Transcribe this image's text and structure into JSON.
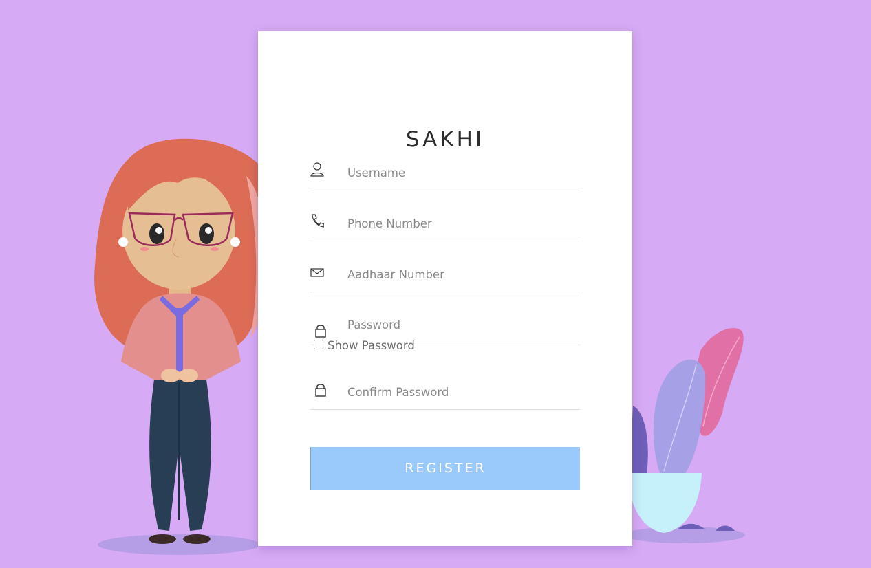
{
  "app": {
    "title": "SAKHI"
  },
  "form": {
    "username": {
      "placeholder": "Username",
      "icon": "user-icon"
    },
    "phone": {
      "placeholder": "Phone Number",
      "icon": "phone-icon"
    },
    "aadhaar": {
      "placeholder": "Aadhaar Number",
      "icon": "envelope-icon"
    },
    "password": {
      "placeholder": "Password",
      "icon": "lock-icon"
    },
    "show_password": {
      "label": "Show Password",
      "checked": false
    },
    "confirm_password": {
      "placeholder": "Confirm Password",
      "icon": "lock-icon"
    },
    "register_label": "REGISTER"
  },
  "colors": {
    "background": "#d6aaf4",
    "card": "#ffffff",
    "button": "#99cafb",
    "title": "#2b2b2b"
  }
}
